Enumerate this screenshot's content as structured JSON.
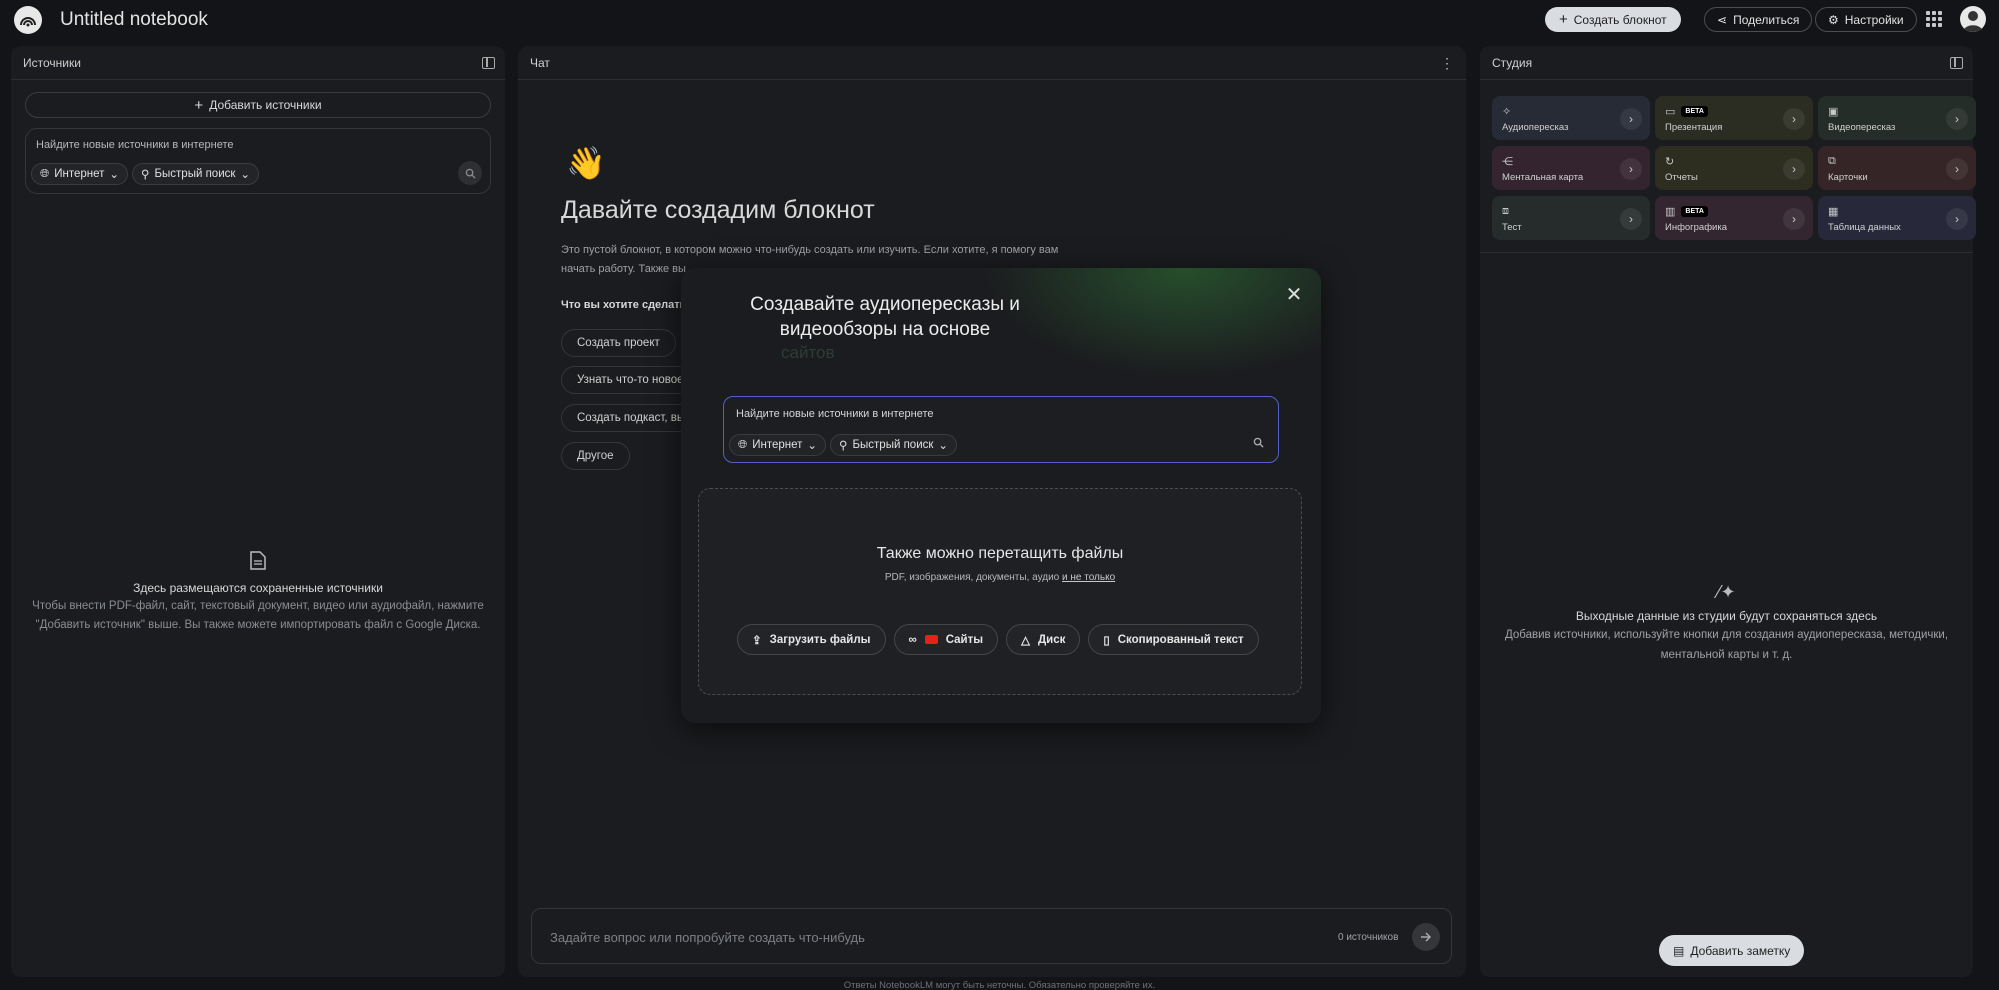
{
  "header": {
    "title": "Untitled notebook",
    "create_label": "Создать блокнот",
    "share_label": "Поделиться",
    "settings_label": "Настройки"
  },
  "sources": {
    "title": "Источники",
    "add_label": "Добавить источники",
    "search_placeholder": "Найдите новые источники в интернете",
    "chip_web": "Интернет",
    "chip_fast": "Быстрый поиск",
    "empty_title": "Здесь размещаются сохраненные источники",
    "empty_text": "Чтобы внести PDF-файл, сайт, текстовый документ, видео или аудиофайл, нажмите \"Добавить источник\" выше. Вы также можете импортировать файл с Google Диска."
  },
  "chat": {
    "title": "Чат",
    "heading": "Давайте создадим блокнот",
    "description": "Это пустой блокнот, в котором можно что-нибудь создать или изучить. Если хотите, я помогу вам начать работу. Также вы",
    "question": "Что вы хотите сделать",
    "suggestions": [
      "Создать проект",
      "Узнать что-то новое",
      "Создать подкаст, вы",
      "Другое"
    ],
    "input_placeholder": "Задайте вопрос или попробуйте создать что-нибудь",
    "source_count": "0 источников",
    "disclaimer": "Ответы NotebookLM могут быть неточны. Обязательно проверяйте их."
  },
  "studio": {
    "title": "Студия",
    "beta": "BETA",
    "tiles": [
      {
        "label": "Аудиопересказ",
        "color": "#272b36",
        "icon": "audio-icon",
        "glyph": "✧"
      },
      {
        "label": "Презентация",
        "color": "#2c2d22",
        "icon": "slides-icon",
        "glyph": "▭",
        "beta": true
      },
      {
        "label": "Видеопересказ",
        "color": "#242d27",
        "icon": "video-icon",
        "glyph": "▣"
      },
      {
        "label": "Ментальная карта",
        "color": "#342430",
        "icon": "mindmap-icon",
        "glyph": "⋲"
      },
      {
        "label": "Отчеты",
        "color": "#2d2d20",
        "icon": "reports-icon",
        "glyph": "↻"
      },
      {
        "label": "Карточки",
        "color": "#352526",
        "icon": "cards-icon",
        "glyph": "⧉"
      },
      {
        "label": "Тест",
        "color": "#262c2c",
        "icon": "test-icon",
        "glyph": "⧈"
      },
      {
        "label": "Инфографика",
        "color": "#332630",
        "icon": "infographic-icon",
        "glyph": "▥",
        "beta": true
      },
      {
        "label": "Таблица данных",
        "color": "#27293a",
        "icon": "table-icon",
        "glyph": "▦"
      }
    ],
    "empty_title": "Выходные данные из студии будут сохраняться здесь",
    "empty_text": "Добавив источники, используйте кнопки для создания аудиопересказа, методички, ментальной карты и т. д.",
    "add_note_label": "Добавить заметку"
  },
  "modal": {
    "title": "Создавайте аудиопересказы и видеообзоры на основе",
    "ghost_word": "сайтов",
    "search_placeholder": "Найдите новые источники в интернете",
    "chip_web": "Интернет",
    "chip_fast": "Быстрый поиск",
    "drop_title": "Также можно перетащить файлы",
    "drop_sub": "PDF, изображения, документы, аудио",
    "drop_link": "и не только",
    "btn_upload": "Загрузить файлы",
    "btn_sites": "Сайты",
    "btn_drive": "Диск",
    "btn_text": "Скопированный текст"
  }
}
